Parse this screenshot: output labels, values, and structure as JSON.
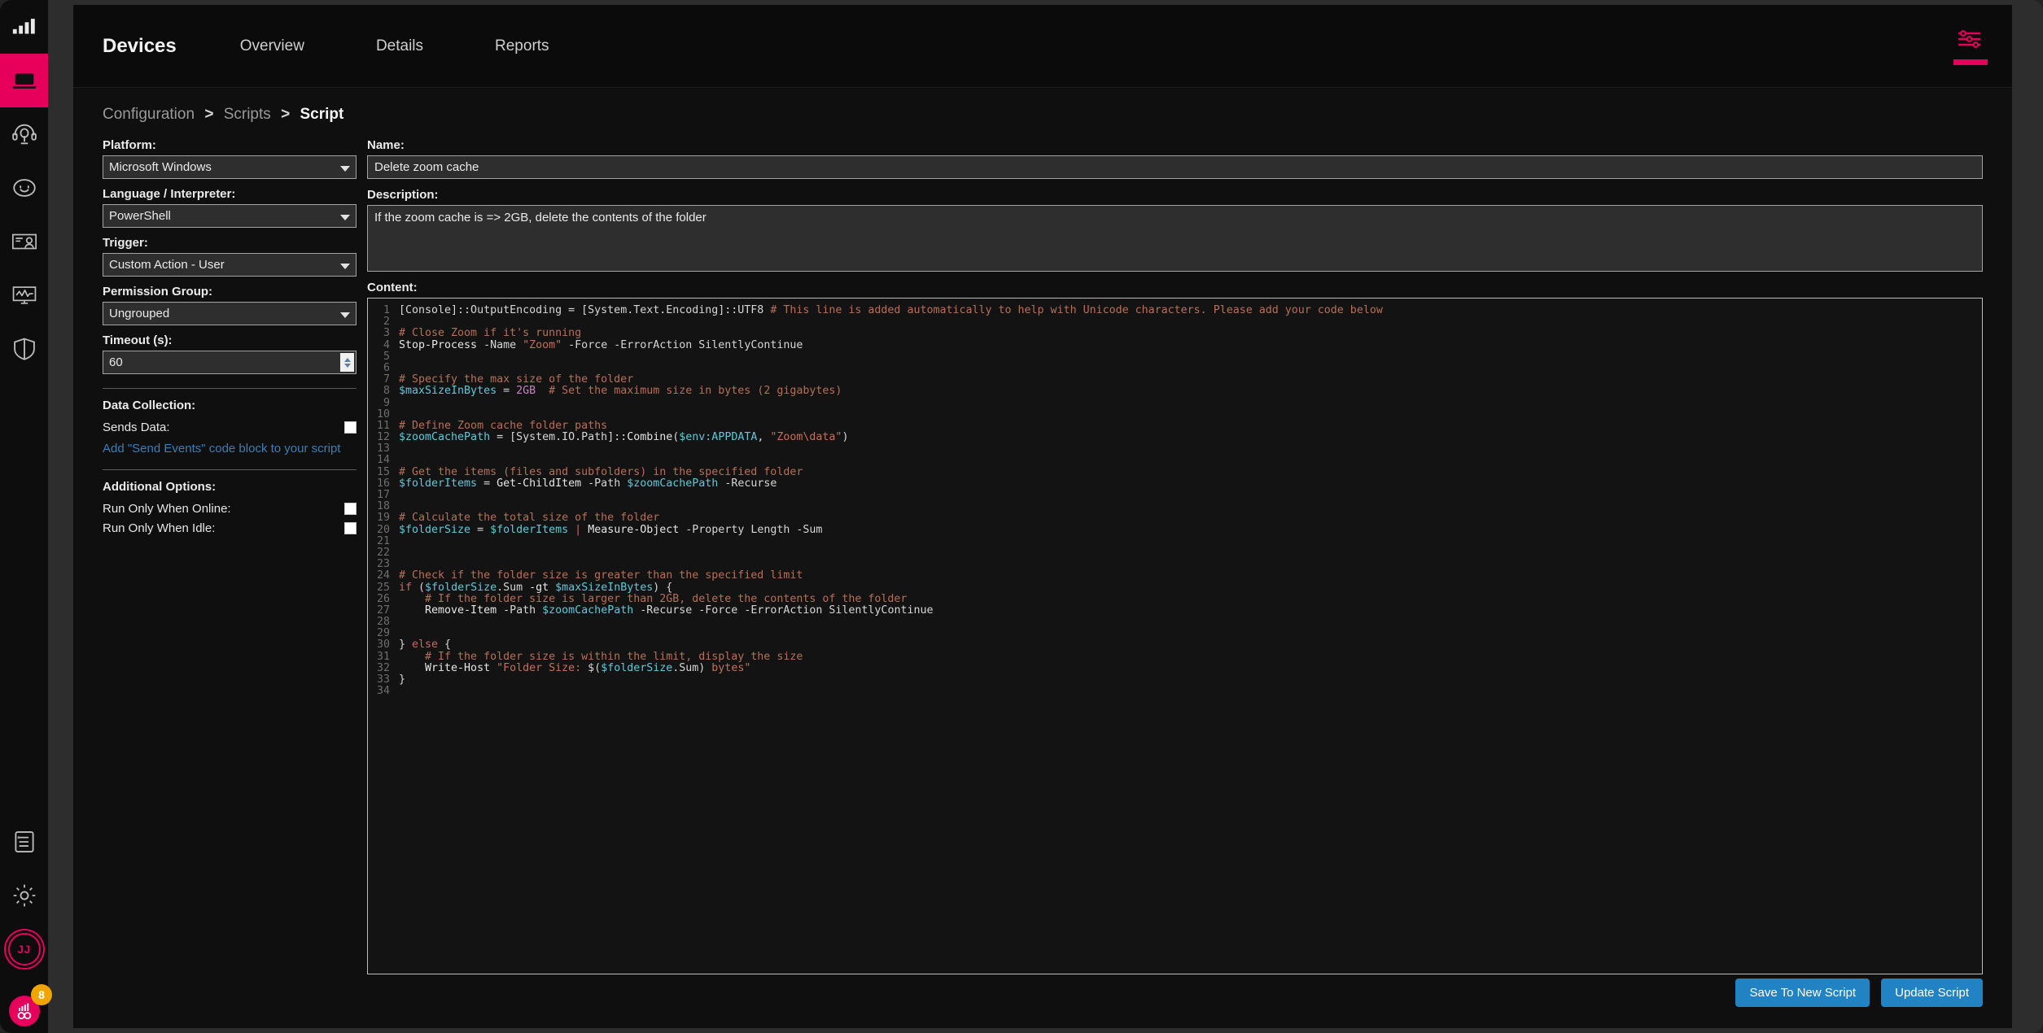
{
  "sidebar": {
    "items": [
      {
        "name": "signal-bars-icon",
        "label": "Dashboard"
      },
      {
        "name": "laptop-icon",
        "label": "Devices",
        "active": true
      },
      {
        "name": "headset-icon",
        "label": "Support"
      },
      {
        "name": "smiley-face-icon",
        "label": "Satisfaction"
      },
      {
        "name": "contact-card-icon",
        "label": "Contacts"
      },
      {
        "name": "monitor-activity-icon",
        "label": "Monitoring"
      },
      {
        "name": "shield-icon",
        "label": "Security"
      }
    ],
    "bottom": [
      {
        "name": "list-document-icon",
        "label": "Logs"
      },
      {
        "name": "gear-icon",
        "label": "Settings"
      }
    ],
    "avatar_initials": "JJ",
    "launcher_badge": "8"
  },
  "topnav": {
    "title": "Devices",
    "links": [
      "Overview",
      "Details",
      "Reports"
    ],
    "right_icon": "sliders-filter-icon"
  },
  "breadcrumb": {
    "items": [
      "Configuration",
      "Scripts"
    ],
    "separator": ">",
    "current": "Script"
  },
  "form": {
    "platform": {
      "label": "Platform:",
      "value": "Microsoft Windows"
    },
    "language": {
      "label": "Language / Interpreter:",
      "value": "PowerShell"
    },
    "trigger": {
      "label": "Trigger:",
      "value": "Custom Action - User"
    },
    "permission_group": {
      "label": "Permission Group:",
      "value": "Ungrouped"
    },
    "timeout": {
      "label": "Timeout (s):",
      "value": "60"
    },
    "data_collection": {
      "heading": "Data Collection:",
      "sends_data_label": "Sends Data:",
      "sends_data_checked": false,
      "link": "Add \"Send Events\" code block to your script"
    },
    "additional_options": {
      "heading": "Additional Options:",
      "run_online_label": "Run Only When Online:",
      "run_online_checked": false,
      "run_idle_label": "Run Only When Idle:",
      "run_idle_checked": false
    },
    "name": {
      "label": "Name:",
      "value": "Delete zoom cache"
    },
    "description": {
      "label": "Description:",
      "value": "If the zoom cache is => 2GB, delete the contents of the folder"
    },
    "content_label": "Content:"
  },
  "editor": {
    "language": "PowerShell",
    "total_lines": 34,
    "lines": [
      {
        "n": 1,
        "tokens": [
          {
            "t": "[Console]::OutputEncoding ",
            "c": "c-op"
          },
          {
            "t": "= ",
            "c": "c-op"
          },
          {
            "t": "[System.Text.Encoding]::UTF8 ",
            "c": "c-op"
          },
          {
            "t": "# This line is added automatically to help with Unicode characters. Please add your code below",
            "c": "c-com"
          }
        ]
      },
      {
        "n": 2,
        "tokens": []
      },
      {
        "n": 3,
        "tokens": [
          {
            "t": "# Close Zoom if it's running",
            "c": "c-com"
          }
        ]
      },
      {
        "n": 4,
        "tokens": [
          {
            "t": "Stop-Process ",
            "c": "c-fn"
          },
          {
            "t": "-Name ",
            "c": "c-op"
          },
          {
            "t": "\"Zoom\" ",
            "c": "c-str"
          },
          {
            "t": "-Force -ErrorAction SilentlyContinue",
            "c": "c-op"
          }
        ]
      },
      {
        "n": 5,
        "tokens": []
      },
      {
        "n": 6,
        "tokens": []
      },
      {
        "n": 7,
        "tokens": [
          {
            "t": "# Specify the max size of the folder",
            "c": "c-com"
          }
        ]
      },
      {
        "n": 8,
        "tokens": [
          {
            "t": "$maxSizeInBytes ",
            "c": "c-var"
          },
          {
            "t": "= ",
            "c": "c-op"
          },
          {
            "t": "2GB ",
            "c": "c-num"
          },
          {
            "t": " # Set the maximum size in bytes (2 gigabytes)",
            "c": "c-com"
          }
        ]
      },
      {
        "n": 9,
        "tokens": []
      },
      {
        "n": 10,
        "tokens": []
      },
      {
        "n": 11,
        "tokens": [
          {
            "t": "# Define Zoom cache folder paths",
            "c": "c-com"
          }
        ]
      },
      {
        "n": 12,
        "tokens": [
          {
            "t": "$zoomCachePath ",
            "c": "c-var"
          },
          {
            "t": "= ",
            "c": "c-op"
          },
          {
            "t": "[System.IO.Path]::",
            "c": "c-op"
          },
          {
            "t": "Combine",
            "c": "c-fn"
          },
          {
            "t": "(",
            "c": "c-op"
          },
          {
            "t": "$env:APPDATA",
            "c": "c-var"
          },
          {
            "t": ", ",
            "c": "c-op"
          },
          {
            "t": "\"Zoom\\data\"",
            "c": "c-str"
          },
          {
            "t": ")",
            "c": "c-op"
          }
        ]
      },
      {
        "n": 13,
        "tokens": []
      },
      {
        "n": 14,
        "tokens": []
      },
      {
        "n": 15,
        "tokens": [
          {
            "t": "# Get the items (files and subfolders) in the specified folder",
            "c": "c-com"
          }
        ]
      },
      {
        "n": 16,
        "tokens": [
          {
            "t": "$folderItems ",
            "c": "c-var"
          },
          {
            "t": "= ",
            "c": "c-op"
          },
          {
            "t": "Get-ChildItem ",
            "c": "c-fn"
          },
          {
            "t": "-Path ",
            "c": "c-op"
          },
          {
            "t": "$zoomCachePath ",
            "c": "c-var"
          },
          {
            "t": "-Recurse",
            "c": "c-op"
          }
        ]
      },
      {
        "n": 17,
        "tokens": []
      },
      {
        "n": 18,
        "tokens": []
      },
      {
        "n": 19,
        "tokens": [
          {
            "t": "# Calculate the total size of the folder",
            "c": "c-com"
          }
        ]
      },
      {
        "n": 20,
        "tokens": [
          {
            "t": "$folderSize ",
            "c": "c-var"
          },
          {
            "t": "= ",
            "c": "c-op"
          },
          {
            "t": "$folderItems ",
            "c": "c-var"
          },
          {
            "t": "| ",
            "c": "c-kw"
          },
          {
            "t": "Measure-Object ",
            "c": "c-fn"
          },
          {
            "t": "-Property Length -Sum",
            "c": "c-op"
          }
        ]
      },
      {
        "n": 21,
        "tokens": []
      },
      {
        "n": 22,
        "tokens": []
      },
      {
        "n": 23,
        "tokens": []
      },
      {
        "n": 24,
        "tokens": [
          {
            "t": "# Check if the folder size is greater than the specified limit",
            "c": "c-com"
          }
        ]
      },
      {
        "n": 25,
        "tokens": [
          {
            "t": "if ",
            "c": "c-kw"
          },
          {
            "t": "(",
            "c": "c-op"
          },
          {
            "t": "$folderSize",
            "c": "c-var"
          },
          {
            "t": ".Sum ",
            "c": "c-op"
          },
          {
            "t": "-gt ",
            "c": "c-fn"
          },
          {
            "t": "$maxSizeInBytes",
            "c": "c-var"
          },
          {
            "t": ") {",
            "c": "c-op"
          }
        ]
      },
      {
        "n": 26,
        "tokens": [
          {
            "t": "    # If the folder size is larger than 2GB, delete the contents of the folder",
            "c": "c-com"
          }
        ]
      },
      {
        "n": 27,
        "tokens": [
          {
            "t": "    Remove-Item ",
            "c": "c-fn"
          },
          {
            "t": "-Path ",
            "c": "c-op"
          },
          {
            "t": "$zoomCachePath ",
            "c": "c-var"
          },
          {
            "t": "-Recurse -Force -ErrorAction SilentlyContinue",
            "c": "c-op"
          }
        ]
      },
      {
        "n": 28,
        "tokens": []
      },
      {
        "n": 29,
        "tokens": []
      },
      {
        "n": 30,
        "tokens": [
          {
            "t": "} ",
            "c": "c-op"
          },
          {
            "t": "else ",
            "c": "c-kw"
          },
          {
            "t": "{",
            "c": "c-op"
          }
        ]
      },
      {
        "n": 31,
        "tokens": [
          {
            "t": "    # If the folder size is within the limit, display the size",
            "c": "c-com"
          }
        ]
      },
      {
        "n": 32,
        "tokens": [
          {
            "t": "    Write-Host ",
            "c": "c-fn"
          },
          {
            "t": "\"Folder Size: ",
            "c": "c-str"
          },
          {
            "t": "$(",
            "c": "c-op"
          },
          {
            "t": "$folderSize",
            "c": "c-var"
          },
          {
            "t": ".Sum",
            "c": "c-op"
          },
          {
            "t": ") ",
            "c": "c-op"
          },
          {
            "t": "bytes\"",
            "c": "c-str"
          }
        ]
      },
      {
        "n": 33,
        "tokens": [
          {
            "t": "}",
            "c": "c-op"
          }
        ]
      },
      {
        "n": 34,
        "tokens": []
      }
    ]
  },
  "footer": {
    "save_new_label": "Save To New Script",
    "update_label": "Update Script"
  },
  "colors": {
    "accent_pink": "#e6005c",
    "button_blue": "#2183c4",
    "link_blue": "#3d7eb8",
    "badge_orange": "#f0a500"
  }
}
